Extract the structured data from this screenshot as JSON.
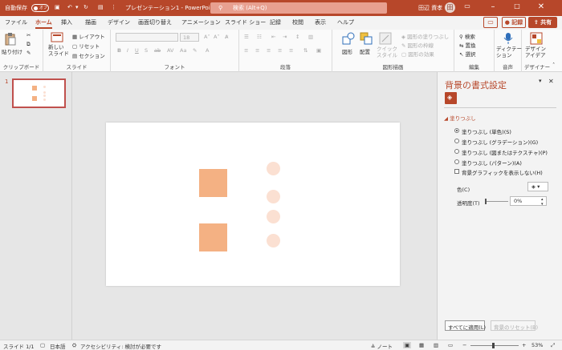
{
  "titlebar": {
    "autosave_label": "自動保存",
    "autosave_state": "オフ",
    "doc_title": "プレゼンテーション1 - PowerPoint",
    "search_placeholder": "検索 (Alt+Q)",
    "user_name": "田辺 資孝",
    "avatar_initial": "田"
  },
  "tabs": [
    "ファイル",
    "ホーム",
    "挿入",
    "描画",
    "デザイン",
    "画面切り替え",
    "アニメーション",
    "スライド ショー",
    "記録",
    "校閲",
    "表示",
    "ヘルプ"
  ],
  "active_tab": "ホーム",
  "record_label": "記録",
  "share_label": "共有",
  "ribbon": {
    "clipboard": {
      "paste": "貼り付け",
      "label": "クリップボード"
    },
    "slides": {
      "new_slide": "新しい\nスライド",
      "layout": "レイアウト",
      "reset": "リセット",
      "section": "セクション",
      "label": "スライド"
    },
    "font": {
      "size": "18",
      "label": "フォント"
    },
    "paragraph": {
      "label": "段落"
    },
    "drawing": {
      "shapes": "図形",
      "arrange": "配置",
      "quick_style": "クイック\nスタイル",
      "fill": "図形の塗りつぶし",
      "outline": "図形の枠線",
      "effects": "図形の効果",
      "label": "図形描画"
    },
    "editing": {
      "find": "検索",
      "replace": "置換",
      "select": "選択",
      "label": "編集"
    },
    "voice": {
      "dictate": "ディクテー\nション",
      "label": "音声"
    },
    "designer": {
      "design_ideas": "デザイン\nアイデア",
      "label": "デザイナー"
    }
  },
  "thumbnails": {
    "slide_number": "1"
  },
  "format_pane": {
    "title": "背景の書式設定",
    "section": "塗りつぶし",
    "options": [
      "塗りつぶし (単色)(S)",
      "塗りつぶし (グラデーション)(G)",
      "塗りつぶし (図またはテクスチャ)(P)",
      "塗りつぶし (パターン)(A)"
    ],
    "selected_option": 0,
    "hide_graphics": "背景グラフィックを表示しない(H)",
    "color_label": "色(C)",
    "transparency_label": "透明度(T)",
    "transparency_value": "0%",
    "apply_all": "すべてに適用(L)",
    "reset_bg": "背景のリセット(B)"
  },
  "statusbar": {
    "slide_info": "スライド 1/1",
    "language": "日本語",
    "accessibility": "アクセシビリティ: 検討が必要です",
    "notes": "ノート",
    "zoom": "53%"
  },
  "colors": {
    "accent": "#b7472a",
    "shape_fill": "#f4b183",
    "circle_fill": "#fbe0d2"
  }
}
